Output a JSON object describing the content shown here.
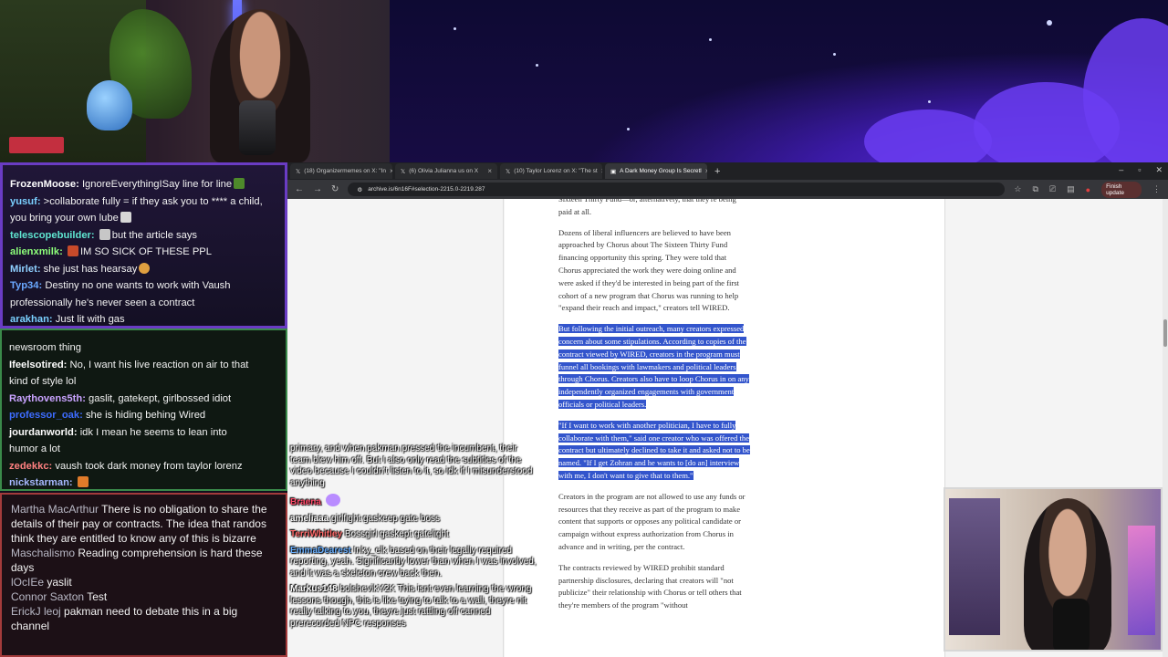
{
  "chat_top": [
    {
      "user": "FrozenMoose:",
      "text": "IgnoreEverythingISay line for line",
      "color": "#ffffff"
    },
    {
      "user": "yusuf:",
      "text": ">collaborate fully = if they ask you to **** a child,",
      "color": "#7ad0ff"
    },
    {
      "user": "",
      "text": "you bring your own lube",
      "color": "#ffffff"
    },
    {
      "user": "telescopebuilder:",
      "text": "but the article says",
      "color": "#5fe6d1"
    },
    {
      "user": "alienxmilk:",
      "text": "IM SO SICK OF THESE PPL",
      "color": "#8dff7a"
    },
    {
      "user": "Mirlet:",
      "text": "she just has hearsay",
      "color": "#8fd0ff"
    },
    {
      "user": "Typ34:",
      "text": "Destiny no one wants to work with Vaush",
      "color": "#6aa8ff"
    },
    {
      "user": "",
      "text": "professionally he's never seen a contract",
      "color": "#ffffff"
    },
    {
      "user": "arakhan:",
      "text": "Just lit with gas",
      "color": "#7ad0ff"
    }
  ],
  "chat_mid": [
    {
      "user": "",
      "text": "newsroom thing",
      "color": "#ffffff"
    },
    {
      "user": "Ifeelsotired:",
      "text": "No, I want his live reaction on air to that",
      "color": "#ffffff"
    },
    {
      "user": "",
      "text": "kind of style lol",
      "color": "#ffffff"
    },
    {
      "user": "Raythovens5th:",
      "text": "gaslit, gatekept, girlbossed idiot",
      "color": "#c9a3ff"
    },
    {
      "user": "professor_oak:",
      "text": "she is hiding behing Wired",
      "color": "#3d6cff"
    },
    {
      "user": "jourdanworld:",
      "text": "idk I mean he seems to lean into",
      "color": "#ffffff"
    },
    {
      "user": "",
      "text": "humor a lot",
      "color": "#ffffff"
    },
    {
      "user": "zedekkc:",
      "text": "vaush took dark money from taylor lorenz",
      "color": "#ff8080"
    },
    {
      "user": "nickstarman:",
      "text": "",
      "color": "#a7b8ff"
    }
  ],
  "chat_bot": [
    {
      "user": "Martha MacArthur",
      "text": "There is no obligation to share the details of their pay or contracts. The idea that randos think they are entitled to know any of this is bizarre"
    },
    {
      "user": "Maschalismo",
      "text": "Reading comprehension is hard these days"
    },
    {
      "user": "lOcIEe",
      "text": "yaslit"
    },
    {
      "user": "Connor Saxton",
      "text": "Test"
    },
    {
      "user": "ErickJ leoj",
      "text": "pakman need to debate this in a big channel"
    }
  ],
  "tabs": [
    {
      "label": "(18) Organizermemes on X: \"In",
      "active": false
    },
    {
      "label": "(6) Olivia Julianna us on X",
      "active": false
    },
    {
      "label": "(10) Taylor Lorenz on X: \"The st",
      "active": false
    },
    {
      "label": "A Dark Money Group Is Secretl",
      "active": true
    }
  ],
  "url": "archive.is/6n16F#selection-2215.0-2219.287",
  "finish_update": "Finish update",
  "article": {
    "p0": "Sixteen Thirty Fund—or, alternatively, that they're being paid at all.",
    "p1": "Dozens of liberal influencers are believed to have been approached by Chorus about The Sixteen Thirty Fund financing opportunity this spring. They were told that Chorus appreciated the work they were doing online and were asked if they'd be interested in being part of the first cohort of a new program that Chorus was running to help \"expand their reach and impact,\" creators tell WIRED.",
    "p2": "But following the initial outreach, many creators expressed concern about some stipulations. According to copies of the contract viewed by WIRED, creators in the program must funnel all bookings with lawmakers and political leaders through Chorus. Creators also have to loop Chorus in on any independently organized engagements with government officials or political leaders.",
    "p3": "\"If I want to work with another politician, I have to fully collaborate with them,\" said one creator who was offered the contract but ultimately declined to take it and asked not to be named. \"If I get Zohran and he wants to [do an] interview with me, I don't want to give that to them.\"",
    "p4": "Creators in the program are not allowed to use any funds or resources that they receive as part of the program to make content that supports or opposes any political candidate or campaign without express authorization from Chorus in advance and in writing, per the contract.",
    "p5": "The contracts reviewed by WIRED prohibit standard partnership disclosures, declaring that creators will \"not publicize\" their relationship with Chorus or tell others that they're members of the program \"without"
  },
  "overlay": [
    {
      "user": "",
      "text": "primary, and when pakman pressed the incumbent, their team blew him off. But I also only read the subtitles of the video because I couldn't listen to it, so idk if I misunderstood anything",
      "color": "#ffffff"
    },
    {
      "user": "Braena",
      "text": "",
      "color": "#ff4a6a"
    },
    {
      "user": "ameliaaa",
      "text": "girlfight gaskeep gate boss",
      "color": "#ffffff"
    },
    {
      "user": "TerriWhitley",
      "text": "Bossgirl gaskept gatelight",
      "color": "#ff6a6a"
    },
    {
      "user": "EmmaDearest",
      "text": "Inky_elk based on their legally required reporting, yeah. Significantly lower than when I was involved, and it was a skeleton crew back then.",
      "color": "#6ab0ff"
    },
    {
      "user": "Markus148",
      "text": "bolshevikY2K This isnt even learning the wrong lessons though, this is like trying to talk to a wall, theyre nit really talking to you, theyre just rattling off canned prerecorded NPC responses",
      "color": "#ffffff"
    }
  ]
}
